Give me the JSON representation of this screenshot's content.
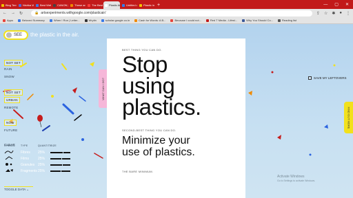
{
  "browser": {
    "tabs": [
      {
        "label": "Blog Temp",
        "color": "#f0c200",
        "active": false
      },
      {
        "label": "Nishka W",
        "color": "#5a6bd6",
        "active": false
      },
      {
        "label": "Best Web",
        "color": "#3b7be8",
        "active": false
      },
      {
        "label": "CANON |",
        "color": "#444444",
        "active": false
      },
      {
        "label": "These are",
        "color": "#f08a00",
        "active": false
      },
      {
        "label": "The Best V",
        "color": "#ff3d3d",
        "active": false
      },
      {
        "label": "Plastic Air",
        "color": "#ffffff",
        "active": true
      },
      {
        "label": "Untitled d",
        "color": "#2f7df0",
        "active": false
      },
      {
        "label": "Plastic in",
        "color": "#f5c400",
        "active": false
      }
    ],
    "new_tab": "+",
    "window_controls": {
      "minimize": "—",
      "maximize": "▢",
      "close": "✕"
    },
    "address": "artsexperiments.withgoogle.com/plasticair/",
    "bookmarks": [
      {
        "label": "Apps",
        "color": "#e8453c"
      },
      {
        "label": "Beloved Summary",
        "color": "#3b7be8"
      },
      {
        "label": "When I Run | Letter...",
        "color": "#3b7be8"
      },
      {
        "label": "Wrytin",
        "color": "#333333"
      },
      {
        "label": "scholar.google.co.in",
        "color": "#3b7be8"
      },
      {
        "label": "Cash for Words: A B...",
        "color": "#f08a00"
      },
      {
        "label": "Because I could not...",
        "color": "#e8453c"
      },
      {
        "label": "Red T Media - Lifest...",
        "color": "#c21a1a"
      },
      {
        "label": "Why You Should Co...",
        "color": "#3b5998"
      },
      {
        "label": "Reading list",
        "color": "#555555"
      }
    ]
  },
  "app": {
    "see_label": "SEE",
    "headline": "the plastic in the air.",
    "filters": {
      "weather_not_set": "NOT SET",
      "rain": "RAIN",
      "snow": "SNOW",
      "area_not_set": "NOT SET",
      "urban": "URBAN",
      "remote": "REMOTE",
      "time_now": "NOW",
      "future": "FUTURE",
      "clear": "CLEAR"
    },
    "side_tab_left": "WHAT CAN I DO?",
    "side_tab_right": "FIND OUT MORE",
    "save_leftovers": "SAVE MY LEFTOVERS",
    "paper": {
      "eyebrow1": "BEST THING YOU CAN DO.",
      "big_line1": "Stop",
      "big_line2": "using",
      "big_line3": "plastics.",
      "eyebrow2": "SECOND-BEST THING YOU CAN DO.",
      "medium_line1": "Minimize your",
      "medium_line2": "use of plastics.",
      "eyebrow3": "THE BARE MINIMUM."
    },
    "legend": {
      "headers": {
        "symbol": "SYMBOL",
        "type": "TYPE",
        "quantity": "QUANTITY",
        "size": "SIZE"
      },
      "rows": [
        {
          "type": "Fibres",
          "quantity": "25%"
        },
        {
          "type": "Films",
          "quantity": "25%"
        },
        {
          "type": "Granules",
          "quantity": "25%"
        },
        {
          "type": "Fragments",
          "quantity": "25%"
        }
      ]
    },
    "toggle_data": "TOGGLE DATA ⌄",
    "watermark": {
      "title": "Activate Windows",
      "subtitle": "Go to Settings to activate Windows."
    }
  },
  "colors": {
    "browser_red": "#c21a1a",
    "accent_yellow": "#f2e11c",
    "pink": "#f6b7d9",
    "sky": "#b9d6ec"
  }
}
